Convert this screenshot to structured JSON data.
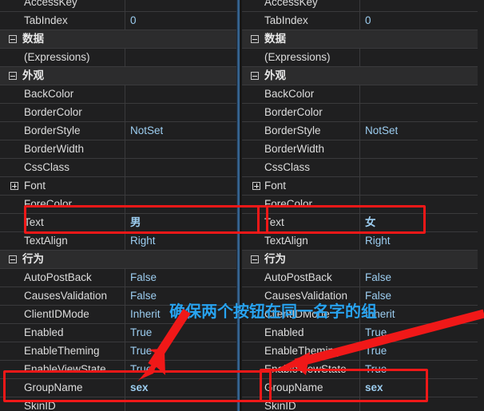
{
  "meta": {
    "window_kind": "visual-studio-properties-grid",
    "panel_count": 2,
    "colors": {
      "background": "#1e1e1e",
      "row_background": "#1f1f20",
      "category_background": "#2c2c2d",
      "grid_line": "#3a3a3c",
      "property_name": "#dcdcdc",
      "property_value": "#9ccdf0",
      "annotation_red": "#f01818",
      "annotation_cyan": "#29a3ef",
      "scrollbar_blue": "#3a6d9e"
    }
  },
  "left_panel": {
    "name": "properties-panel-left",
    "rows": [
      {
        "kind": "prop",
        "name": "AccessKey",
        "value": "",
        "clipped_top": true
      },
      {
        "kind": "prop",
        "name": "TabIndex",
        "value": "0"
      },
      {
        "kind": "cat",
        "name": "数据",
        "value": "",
        "expander": "minus"
      },
      {
        "kind": "prop",
        "name": "(Expressions)",
        "value": ""
      },
      {
        "kind": "cat",
        "name": "外观",
        "value": "",
        "expander": "minus"
      },
      {
        "kind": "prop",
        "name": "BackColor",
        "value": ""
      },
      {
        "kind": "prop",
        "name": "BorderColor",
        "value": ""
      },
      {
        "kind": "prop",
        "name": "BorderStyle",
        "value": "NotSet"
      },
      {
        "kind": "prop",
        "name": "BorderWidth",
        "value": ""
      },
      {
        "kind": "prop",
        "name": "CssClass",
        "value": ""
      },
      {
        "kind": "prop",
        "name": "Font",
        "value": "",
        "expander": "plus"
      },
      {
        "kind": "prop",
        "name": "ForeColor",
        "value": ""
      },
      {
        "kind": "prop",
        "name": "Text",
        "value": "男",
        "value_style": "cjk",
        "highlighted": true
      },
      {
        "kind": "prop",
        "name": "TextAlign",
        "value": "Right"
      },
      {
        "kind": "cat",
        "name": "行为",
        "value": "",
        "expander": "minus"
      },
      {
        "kind": "prop",
        "name": "AutoPostBack",
        "value": "False"
      },
      {
        "kind": "prop",
        "name": "CausesValidation",
        "value": "False"
      },
      {
        "kind": "prop",
        "name": "ClientIDMode",
        "value": "Inherit"
      },
      {
        "kind": "prop",
        "name": "Enabled",
        "value": "True"
      },
      {
        "kind": "prop",
        "name": "EnableTheming",
        "value": "True"
      },
      {
        "kind": "prop",
        "name": "EnableViewState",
        "value": "True"
      },
      {
        "kind": "prop",
        "name": "GroupName",
        "value": "sex",
        "value_style": "bold",
        "highlighted": true
      },
      {
        "kind": "prop",
        "name": "SkinID",
        "value": ""
      }
    ]
  },
  "right_panel": {
    "name": "properties-panel-right",
    "rows": [
      {
        "kind": "prop",
        "name": "AccessKey",
        "value": "",
        "clipped_top": true
      },
      {
        "kind": "prop",
        "name": "TabIndex",
        "value": "0"
      },
      {
        "kind": "cat",
        "name": "数据",
        "value": "",
        "expander": "minus"
      },
      {
        "kind": "prop",
        "name": "(Expressions)",
        "value": ""
      },
      {
        "kind": "cat",
        "name": "外观",
        "value": "",
        "expander": "minus"
      },
      {
        "kind": "prop",
        "name": "BackColor",
        "value": ""
      },
      {
        "kind": "prop",
        "name": "BorderColor",
        "value": ""
      },
      {
        "kind": "prop",
        "name": "BorderStyle",
        "value": "NotSet"
      },
      {
        "kind": "prop",
        "name": "BorderWidth",
        "value": ""
      },
      {
        "kind": "prop",
        "name": "CssClass",
        "value": ""
      },
      {
        "kind": "prop",
        "name": "Font",
        "value": "",
        "expander": "plus"
      },
      {
        "kind": "prop",
        "name": "ForeColor",
        "value": ""
      },
      {
        "kind": "prop",
        "name": "Text",
        "value": "女",
        "value_style": "cjk",
        "highlighted": true
      },
      {
        "kind": "prop",
        "name": "TextAlign",
        "value": "Right"
      },
      {
        "kind": "cat",
        "name": "行为",
        "value": "",
        "expander": "minus"
      },
      {
        "kind": "prop",
        "name": "AutoPostBack",
        "value": "False"
      },
      {
        "kind": "prop",
        "name": "CausesValidation",
        "value": "False"
      },
      {
        "kind": "prop",
        "name": "ClientIDMode",
        "value": "Inherit"
      },
      {
        "kind": "prop",
        "name": "Enabled",
        "value": "True"
      },
      {
        "kind": "prop",
        "name": "EnableTheming",
        "value": "True"
      },
      {
        "kind": "prop",
        "name": "EnableViewState",
        "value": "True"
      },
      {
        "kind": "prop",
        "name": "GroupName",
        "value": "sex",
        "value_style": "bold",
        "highlighted": true
      },
      {
        "kind": "prop",
        "name": "SkinID",
        "value": ""
      }
    ]
  },
  "annotations": {
    "note_text": "确保两个按钮在同一名字的组",
    "highlight_boxes": [
      {
        "id": "text-row-left",
        "label": "Text 男 row highlight"
      },
      {
        "id": "text-row-right",
        "label": "Text 女 row highlight"
      },
      {
        "id": "groupname-row-left",
        "label": "GroupName sex row highlight"
      },
      {
        "id": "groupname-row-right",
        "label": "GroupName sex row highlight"
      }
    ],
    "arrows": [
      {
        "id": "arrow-left",
        "label": "arrow pointing to left GroupName row"
      },
      {
        "id": "arrow-right",
        "label": "arrow pointing to right GroupName row"
      }
    ]
  }
}
